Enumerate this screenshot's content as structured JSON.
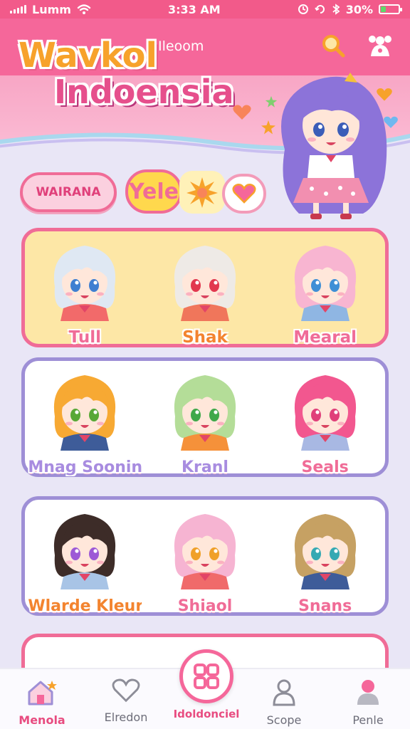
{
  "status_bar": {
    "carrier": "Lumm",
    "time": "3:33 AM",
    "battery": "30%",
    "battery_level": 0.3
  },
  "header": {
    "subtitle": "Ileoom",
    "search_icon": "search-icon",
    "menu_icon": "character-icon"
  },
  "brand": {
    "line1": "Wavkol",
    "line2": "Indoensia"
  },
  "filters": {
    "pill_label": "WAIRANA",
    "chip_label": "Yele"
  },
  "rows": [
    {
      "characters": [
        {
          "name": "Tull",
          "hair": "#dfe8f3",
          "eyes": "#3f7fd1",
          "shirt": "#f26a6a"
        },
        {
          "name": "Shak",
          "hair": "#eeeae6",
          "eyes": "#e2384f",
          "shirt": "#f0765b"
        },
        {
          "name": "Mearal",
          "hair": "#f8b5d1",
          "eyes": "#3f8fd6",
          "shirt": "#8fb6e3"
        }
      ]
    },
    {
      "characters": [
        {
          "name": "Mnag Soonin!",
          "hair": "#f7a933",
          "eyes": "#58a836",
          "shirt": "#3e5c99"
        },
        {
          "name": "Kranl",
          "hair": "#b4dd98",
          "eyes": "#3fa84a",
          "shirt": "#f5913a"
        },
        {
          "name": "Seals",
          "hair": "#f2578f",
          "eyes": "#e0407a",
          "shirt": "#a8b8e3"
        }
      ]
    },
    {
      "characters": [
        {
          "name": "Wlarde Kleur!",
          "hair": "#3d2c28",
          "eyes": "#9d59d6",
          "shirt": "#a8c4e6"
        },
        {
          "name": "Shiaol",
          "hair": "#f6b4d2",
          "eyes": "#f0a028",
          "shirt": "#f06a6a"
        },
        {
          "name": "Snans",
          "hair": "#c6a163",
          "eyes": "#35a9b3",
          "shirt": "#3e5c99"
        }
      ]
    }
  ],
  "nav": {
    "items": [
      {
        "label": "Menola",
        "icon": "home-icon"
      },
      {
        "label": "Elredon",
        "icon": "heart-icon"
      },
      {
        "label": "Scope",
        "icon": "profile-icon"
      },
      {
        "label": "Penle",
        "icon": "person-icon"
      }
    ],
    "center_label": "Idoldonciel",
    "center_icon": "grid-icon"
  },
  "colors": {
    "accent": "#f5679a",
    "brand_orange": "#f7a22b",
    "row_border_pink": "#f06c97",
    "row_border_purple": "#9e8fd6"
  }
}
